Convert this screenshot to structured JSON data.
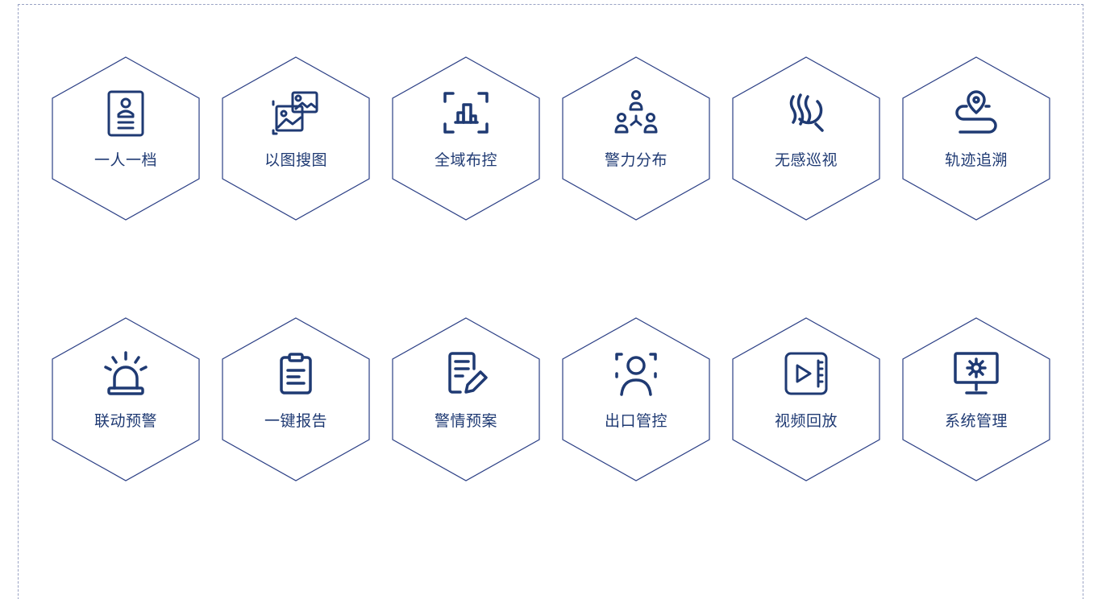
{
  "modules": [
    {
      "id": "profile",
      "label": "一人一档",
      "icon": "id-card-icon"
    },
    {
      "id": "image-search",
      "label": "以图搜图",
      "icon": "image-search-icon"
    },
    {
      "id": "deploy",
      "label": "全域布控",
      "icon": "scan-building-icon"
    },
    {
      "id": "police-dist",
      "label": "警力分布",
      "icon": "people-network-icon"
    },
    {
      "id": "patrol",
      "label": "无感巡视",
      "icon": "wave-search-icon"
    },
    {
      "id": "track",
      "label": "轨迹追溯",
      "icon": "route-pin-icon"
    },
    {
      "id": "alert",
      "label": "联动预警",
      "icon": "alarm-light-icon"
    },
    {
      "id": "report",
      "label": "一键报告",
      "icon": "clipboard-icon"
    },
    {
      "id": "plan",
      "label": "警情预案",
      "icon": "document-edit-icon"
    },
    {
      "id": "exit",
      "label": "出口管控",
      "icon": "face-scan-icon"
    },
    {
      "id": "playback",
      "label": "视频回放",
      "icon": "video-play-icon"
    },
    {
      "id": "system",
      "label": "系统管理",
      "icon": "monitor-gear-icon"
    }
  ],
  "colors": {
    "accent": "#1f3a73",
    "hex_stroke": "#2b3f85",
    "border": "#9aa3c4",
    "background": "#ffffff"
  }
}
